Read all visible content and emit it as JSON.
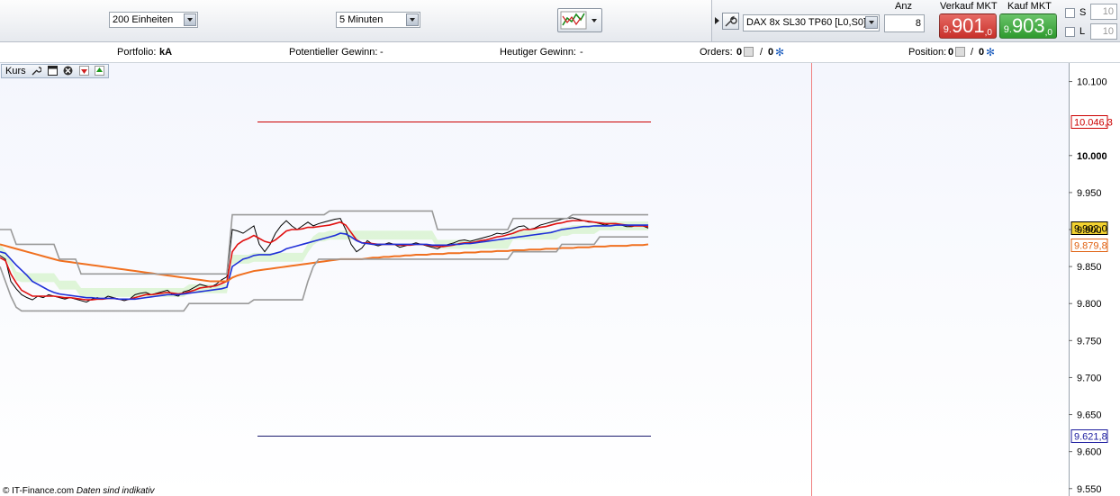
{
  "toolbar": {
    "units_select": "200 Einheiten",
    "interval_select": "5 Minuten"
  },
  "trade": {
    "instrument": "DAX 8x SL30 TP60 [L0,S0]",
    "anz_label": "Anz",
    "anz_value": "8",
    "sell_label": "Verkauf MKT",
    "buy_label": "Kauf MKT",
    "sell_price_pre": "9.",
    "sell_price_big": "901",
    "sell_price_suffix": ",0",
    "buy_price_pre": "9.",
    "buy_price_big": "903",
    "buy_price_suffix": ",0",
    "s_label": "S",
    "l_label": "L",
    "s_value": "10",
    "l_value": "10",
    "sell_color": "#d9403a",
    "buy_color": "#3aa23a"
  },
  "infobar": {
    "portfolio_label": "Portfolio:",
    "portfolio_value": "kA",
    "gewinn_label": "Potentieller Gewinn:",
    "gewinn_value": "-",
    "heute_label": "Heutiger Gewinn:",
    "heute_value": "-",
    "orders_label": "Orders:",
    "orders_a": "0",
    "orders_sep": "/",
    "orders_b": "0",
    "position_label": "Position:",
    "position_a": "0",
    "position_sep": "/",
    "position_b": "0"
  },
  "chart": {
    "panel_label": "Kurs",
    "footer_copyright": "© IT-Finance.com",
    "footer_note": "Daten sind indikativ"
  },
  "chart_data": {
    "type": "line",
    "ylim": [
      9540,
      10125
    ],
    "yticks": [
      "10.100",
      "10.000",
      "9.950",
      "9.900",
      "9.850",
      "9.800",
      "9.750",
      "9.700",
      "9.650",
      "9.600",
      "9.550"
    ],
    "ytick_values": [
      10100,
      10000,
      9950,
      9900,
      9850,
      9800,
      9750,
      9700,
      9650,
      9600,
      9550
    ],
    "levels": [
      {
        "label": "10.046,3",
        "value": 10046.3,
        "color": "#cc0000",
        "box_bg": "#ffffff",
        "text_color": "#cc0000"
      },
      {
        "label": "9.902,0",
        "value": 9902.0,
        "color": "#000000",
        "box_bg": "#f2d230",
        "text_color": "#000000"
      },
      {
        "label": "9.879,8",
        "value": 9879.8,
        "color": "#f07020",
        "box_bg": "#ffffff",
        "text_color": "#e06010"
      },
      {
        "label": "9.621,8",
        "value": 9621.8,
        "color": "#1a1a6e",
        "box_bg": "#ffffff",
        "text_color": "#1a1a9e"
      }
    ],
    "x": [
      0,
      6,
      12,
      18,
      24,
      30,
      36,
      42,
      48,
      54,
      60,
      66,
      72,
      78,
      84,
      90,
      96,
      102,
      108,
      114,
      120,
      126,
      132,
      138,
      144,
      150,
      156,
      162,
      168,
      174,
      180,
      186,
      192,
      198,
      204,
      210,
      216,
      222,
      228,
      234,
      240,
      246,
      252,
      258,
      264,
      270,
      276,
      282,
      288,
      294,
      300,
      306,
      312,
      318,
      324,
      330,
      336,
      342,
      348,
      354,
      360,
      366,
      372,
      378,
      384,
      390,
      396,
      402,
      408,
      414,
      420,
      426,
      432,
      438,
      444,
      450,
      456,
      462,
      468,
      474,
      480,
      486,
      492,
      498,
      504,
      510,
      516,
      522,
      528,
      534,
      540,
      546,
      552,
      558,
      564,
      570,
      576,
      582,
      588,
      594,
      600,
      606,
      612,
      618,
      624,
      630,
      636,
      642,
      648,
      654,
      660,
      666,
      672,
      678,
      684,
      690,
      696,
      702,
      708,
      714,
      720
    ],
    "series": [
      {
        "name": "",
        "color": "#000000",
        "values": [
          9865,
          9860,
          9830,
          9820,
          9812,
          9808,
          9805,
          9810,
          9808,
          9812,
          9810,
          9808,
          9806,
          9808,
          9806,
          9804,
          9802,
          9806,
          9808,
          9806,
          9810,
          9808,
          9806,
          9804,
          9806,
          9812,
          9814,
          9815,
          9812,
          9814,
          9816,
          9818,
          9812,
          9810,
          9816,
          9818,
          9822,
          9826,
          9824,
          9822,
          9826,
          9832,
          9836,
          9900,
          9898,
          9895,
          9900,
          9905,
          9880,
          9870,
          9880,
          9895,
          9905,
          9912,
          9905,
          9900,
          9905,
          9910,
          9905,
          9908,
          9910,
          9912,
          9914,
          9915,
          9900,
          9880,
          9870,
          9875,
          9885,
          9880,
          9878,
          9880,
          9882,
          9880,
          9876,
          9878,
          9880,
          9882,
          9880,
          9878,
          9876,
          9874,
          9878,
          9880,
          9882,
          9885,
          9886,
          9884,
          9886,
          9888,
          9890,
          9892,
          9895,
          9894,
          9896,
          9900,
          9904,
          9905,
          9900,
          9902,
          9906,
          9908,
          9910,
          9912,
          9914,
          9915,
          9916,
          9914,
          9912,
          9910,
          9910,
          9908,
          9906,
          9908,
          9908,
          9906,
          9904,
          9904,
          9906,
          9905,
          9902
        ]
      },
      {
        "name": "",
        "color": "#e01010",
        "values": [
          9862,
          9858,
          9840,
          9828,
          9818,
          9814,
          9810,
          9810,
          9810,
          9810,
          9810,
          9809,
          9808,
          9808,
          9807,
          9806,
          9805,
          9805,
          9806,
          9806,
          9807,
          9807,
          9806,
          9806,
          9806,
          9808,
          9810,
          9812,
          9812,
          9813,
          9814,
          9815,
          9814,
          9813,
          9814,
          9816,
          9818,
          9821,
          9822,
          9823,
          9824,
          9827,
          9830,
          9870,
          9880,
          9885,
          9888,
          9892,
          9888,
          9884,
          9882,
          9886,
          9892,
          9898,
          9900,
          9900,
          9901,
          9903,
          9903,
          9904,
          9905,
          9906,
          9908,
          9910,
          9906,
          9896,
          9886,
          9882,
          9882,
          9881,
          9880,
          9880,
          9880,
          9880,
          9879,
          9879,
          9879,
          9880,
          9880,
          9879,
          9878,
          9877,
          9877,
          9878,
          9879,
          9881,
          9882,
          9882,
          9883,
          9885,
          9886,
          9888,
          9890,
          9891,
          9893,
          9895,
          9898,
          9900,
          9900,
          9901,
          9903,
          9904,
          9906,
          9908,
          9909,
          9911,
          9912,
          9912,
          9912,
          9911,
          9910,
          9909,
          9908,
          9908,
          9908,
          9907,
          9906,
          9905,
          9905,
          9905,
          9904
        ]
      },
      {
        "name": "",
        "color": "#2030d8",
        "values": [
          9870,
          9868,
          9860,
          9852,
          9845,
          9838,
          9830,
          9826,
          9822,
          9818,
          9815,
          9813,
          9812,
          9811,
          9810,
          9809,
          9808,
          9808,
          9807,
          9807,
          9807,
          9807,
          9806,
          9806,
          9806,
          9806,
          9807,
          9808,
          9809,
          9810,
          9811,
          9812,
          9812,
          9812,
          9813,
          9814,
          9815,
          9816,
          9817,
          9818,
          9819,
          9820,
          9822,
          9850,
          9855,
          9860,
          9862,
          9865,
          9866,
          9866,
          9866,
          9868,
          9870,
          9874,
          9876,
          9878,
          9880,
          9882,
          9884,
          9886,
          9888,
          9890,
          9892,
          9895,
          9894,
          9890,
          9885,
          9882,
          9881,
          9880,
          9880,
          9880,
          9880,
          9880,
          9880,
          9880,
          9880,
          9880,
          9880,
          9880,
          9879,
          9879,
          9879,
          9879,
          9880,
          9880,
          9881,
          9881,
          9882,
          9883,
          9884,
          9885,
          9886,
          9887,
          9888,
          9889,
          9890,
          9891,
          9892,
          9893,
          9894,
          9895,
          9896,
          9898,
          9900,
          9901,
          9902,
          9903,
          9904,
          9904,
          9905,
          9905,
          9905,
          9905,
          9906,
          9906,
          9906,
          9906,
          9906,
          9906,
          9906
        ]
      },
      {
        "name": "",
        "color": "#f07020",
        "values": [
          9880,
          9878,
          9876,
          9874,
          9872,
          9870,
          9868,
          9866,
          9864,
          9862,
          9860,
          9858,
          9857,
          9856,
          9855,
          9854,
          9853,
          9852,
          9851,
          9850,
          9849,
          9848,
          9847,
          9846,
          9845,
          9844,
          9843,
          9842,
          9841,
          9840,
          9839,
          9838,
          9837,
          9836,
          9835,
          9834,
          9833,
          9832,
          9831,
          9830,
          9830,
          9830,
          9830,
          9835,
          9838,
          9840,
          9842,
          9844,
          9845,
          9846,
          9847,
          9848,
          9849,
          9850,
          9851,
          9852,
          9853,
          9854,
          9855,
          9856,
          9857,
          9858,
          9859,
          9860,
          9860,
          9860,
          9860,
          9860,
          9861,
          9862,
          9862,
          9863,
          9863,
          9864,
          9864,
          9865,
          9865,
          9866,
          9866,
          9866,
          9867,
          9867,
          9867,
          9868,
          9868,
          9868,
          9869,
          9869,
          9869,
          9870,
          9870,
          9870,
          9871,
          9871,
          9871,
          9872,
          9872,
          9872,
          9873,
          9873,
          9873,
          9874,
          9874,
          9874,
          9875,
          9875,
          9875,
          9876,
          9876,
          9876,
          9877,
          9877,
          9877,
          9878,
          9878,
          9878,
          9878,
          9879,
          9879,
          9879,
          9880
        ]
      },
      {
        "name": "",
        "color": "#9a9a9a",
        "values": [
          9900,
          9900,
          9900,
          9880,
          9880,
          9880,
          9880,
          9880,
          9880,
          9880,
          9880,
          9860,
          9860,
          9860,
          9860,
          9840,
          9840,
          9840,
          9840,
          9840,
          9840,
          9840,
          9840,
          9840,
          9840,
          9840,
          9840,
          9840,
          9840,
          9840,
          9840,
          9840,
          9840,
          9840,
          9840,
          9840,
          9840,
          9840,
          9840,
          9840,
          9840,
          9840,
          9840,
          9920,
          9920,
          9920,
          9920,
          9920,
          9920,
          9920,
          9920,
          9920,
          9920,
          9920,
          9920,
          9920,
          9920,
          9920,
          9920,
          9920,
          9920,
          9925,
          9925,
          9925,
          9925,
          9925,
          9925,
          9925,
          9925,
          9925,
          9925,
          9925,
          9925,
          9925,
          9925,
          9925,
          9925,
          9925,
          9925,
          9925,
          9925,
          9900,
          9900,
          9900,
          9900,
          9900,
          9900,
          9900,
          9900,
          9900,
          9900,
          9900,
          9900,
          9900,
          9900,
          9915,
          9915,
          9915,
          9915,
          9915,
          9915,
          9915,
          9915,
          9915,
          9915,
          9915,
          9920,
          9920,
          9920,
          9920,
          9920,
          9920,
          9920,
          9920,
          9920,
          9920,
          9920,
          9920,
          9920,
          9920,
          9920
        ]
      },
      {
        "name": "",
        "color": "#9a9a9a",
        "values": [
          9850,
          9830,
          9810,
          9795,
          9790,
          9790,
          9790,
          9790,
          9790,
          9790,
          9790,
          9790,
          9790,
          9790,
          9790,
          9790,
          9790,
          9790,
          9790,
          9790,
          9790,
          9790,
          9790,
          9790,
          9790,
          9790,
          9790,
          9790,
          9790,
          9790,
          9790,
          9790,
          9790,
          9790,
          9790,
          9800,
          9800,
          9800,
          9800,
          9800,
          9800,
          9800,
          9800,
          9800,
          9800,
          9800,
          9800,
          9805,
          9805,
          9805,
          9805,
          9805,
          9805,
          9805,
          9805,
          9805,
          9805,
          9830,
          9850,
          9860,
          9860,
          9860,
          9860,
          9860,
          9860,
          9860,
          9860,
          9860,
          9860,
          9860,
          9860,
          9860,
          9860,
          9860,
          9860,
          9860,
          9860,
          9860,
          9860,
          9860,
          9860,
          9860,
          9860,
          9860,
          9860,
          9860,
          9860,
          9860,
          9860,
          9860,
          9860,
          9860,
          9860,
          9860,
          9860,
          9870,
          9870,
          9870,
          9870,
          9870,
          9870,
          9870,
          9870,
          9870,
          9880,
          9880,
          9880,
          9880,
          9880,
          9880,
          9880,
          9890,
          9890,
          9890,
          9890,
          9890,
          9890,
          9890,
          9890,
          9890,
          9890
        ]
      }
    ]
  }
}
